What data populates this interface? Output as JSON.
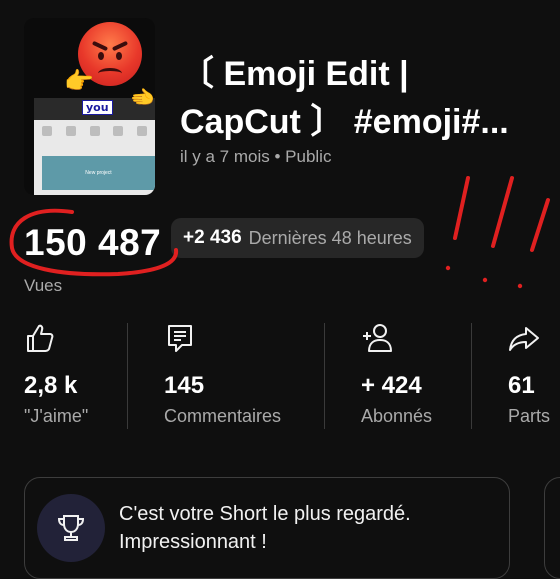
{
  "video": {
    "thumbnail_badge_text": "you",
    "thumbnail_button_text": "New project",
    "title": "〔 Emoji Edit |\nCapCut 〕 #emoji#...",
    "meta": "il y a 7 mois • Public"
  },
  "stats": {
    "views_value": "150 487",
    "views_label": "Vues",
    "recent_delta": "+2 436",
    "recent_label": "Dernières 48 heures"
  },
  "metrics": [
    {
      "icon": "thumb-up-icon",
      "value": "2,8 k",
      "label": "\"J'aime\""
    },
    {
      "icon": "comment-icon",
      "value": "145",
      "label": "Commentaires"
    },
    {
      "icon": "add-person-icon",
      "value": "+ 424",
      "label": "Abonnés"
    },
    {
      "icon": "share-icon",
      "value": "61",
      "label": "Parts"
    }
  ],
  "highlight_card": {
    "icon": "trophy-icon",
    "text": "C'est votre Short le plus regardé. Impressionnant !"
  },
  "colors": {
    "background": "#0f0f0f",
    "chip": "#272727",
    "muted_text": "#aaaaaa",
    "annotation_red": "#e02020"
  }
}
